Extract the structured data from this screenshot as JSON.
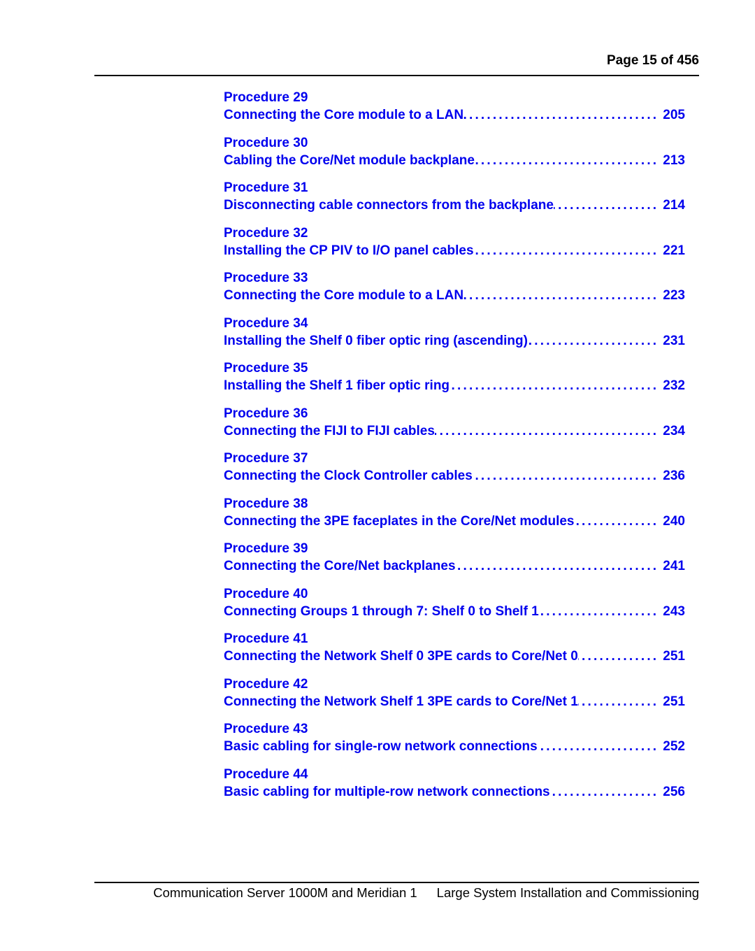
{
  "header": {
    "page_label": "Page 15 of 456"
  },
  "toc": [
    {
      "procedure": "Procedure 29",
      "title": "Connecting the Core module to a LAN",
      "page": "205"
    },
    {
      "procedure": "Procedure 30",
      "title": "Cabling the Core/Net module backplane",
      "page": "213"
    },
    {
      "procedure": "Procedure 31",
      "title": "Disconnecting cable connectors from the backplane",
      "page": "214"
    },
    {
      "procedure": "Procedure 32",
      "title": "Installing the CP PIV to I/O panel cables",
      "page": "221"
    },
    {
      "procedure": "Procedure 33",
      "title": "Connecting the Core module to a LAN",
      "page": "223"
    },
    {
      "procedure": "Procedure 34",
      "title": "Installing the Shelf 0 fiber optic ring (ascending)",
      "page": "231"
    },
    {
      "procedure": "Procedure 35",
      "title": "Installing the Shelf 1 fiber optic ring",
      "page": "232"
    },
    {
      "procedure": "Procedure 36",
      "title": "Connecting the FIJI to FIJI cables",
      "page": "234"
    },
    {
      "procedure": "Procedure 37",
      "title": "Connecting the Clock Controller cables",
      "page": "236"
    },
    {
      "procedure": "Procedure 38",
      "title": "Connecting the 3PE faceplates in the Core/Net modules",
      "page": "240"
    },
    {
      "procedure": "Procedure 39",
      "title": "Connecting the Core/Net backplanes",
      "page": "241"
    },
    {
      "procedure": "Procedure 40",
      "title": "Connecting Groups 1 through 7: Shelf 0 to Shelf 1",
      "page": "243"
    },
    {
      "procedure": "Procedure 41",
      "title": "Connecting the Network Shelf 0 3PE cards to Core/Net 0",
      "page": "251"
    },
    {
      "procedure": "Procedure 42",
      "title": "Connecting the Network Shelf 1 3PE cards to Core/Net 1",
      "page": "251"
    },
    {
      "procedure": "Procedure 43",
      "title": "Basic cabling for single-row network connections",
      "page": "252"
    },
    {
      "procedure": "Procedure 44",
      "title": "Basic cabling for multiple-row network connections",
      "page": "256"
    }
  ],
  "footer": {
    "product": "Communication Server 1000M and Meridian 1",
    "document": "Large System Installation and Commissioning"
  },
  "colors": {
    "link": "#0000ee",
    "text": "#000000"
  }
}
